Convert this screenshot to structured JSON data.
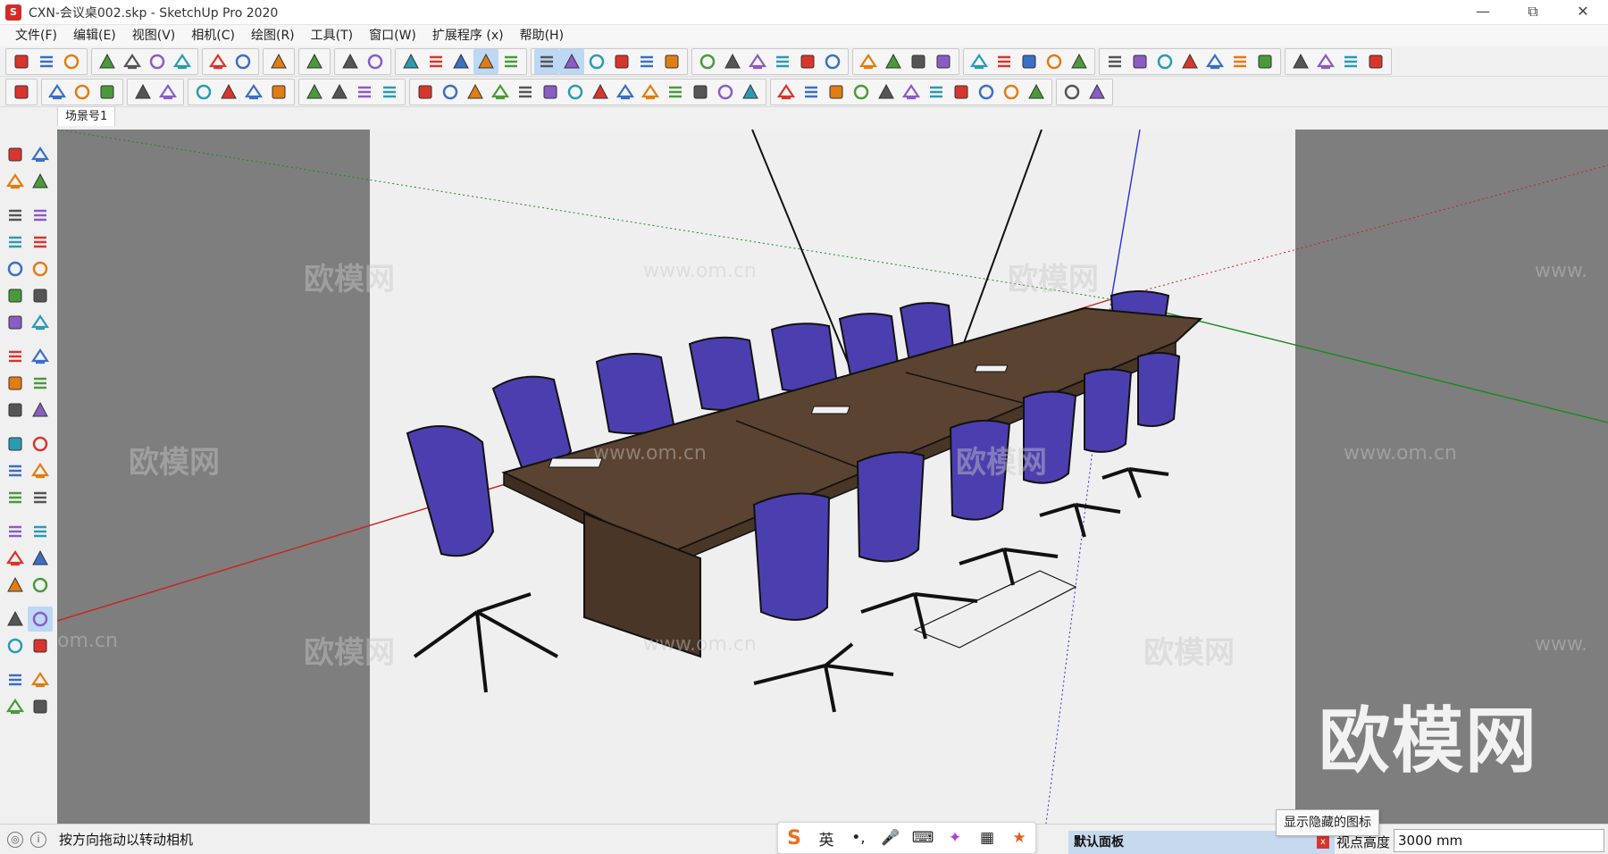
{
  "window": {
    "title": "CXN-会议桌002.skp - SketchUp Pro 2020",
    "controls": [
      "minimize",
      "restore",
      "close"
    ]
  },
  "menu": [
    "文件(F)",
    "编辑(E)",
    "视图(V)",
    "相机(C)",
    "绘图(R)",
    "工具(T)",
    "窗口(W)",
    "扩展程序 (x)",
    "帮助(H)"
  ],
  "toolbar1_groups": [
    [
      "new-icon",
      "open-icon",
      "save-icon"
    ],
    [
      "cut-icon",
      "copy-icon",
      "paste-icon",
      "erase-icon"
    ],
    [
      "undo-icon",
      "redo-icon"
    ],
    [
      "print-icon"
    ],
    [
      "model-info-icon"
    ],
    [
      "xray-icon",
      "back-edges-icon"
    ],
    [
      "wireframe-icon",
      "hidden-line-icon",
      "shaded-icon",
      "shaded-texture-icon",
      "monochrome-icon"
    ],
    [
      "iso-view-icon",
      "top-view-icon",
      "front-view-icon",
      "right-view-icon",
      "back-view-icon",
      "left-view-icon"
    ],
    [
      "component-a-icon",
      "component-b-icon",
      "component-c-icon",
      "component-d-icon",
      "component-e-icon",
      "component-f-icon"
    ],
    [
      "axes-icon",
      "section-icon",
      "display-section-icon",
      "section-fill-icon"
    ],
    [
      "sandbox-a-icon",
      "sandbox-b-icon",
      "sandbox-c-icon",
      "sandbox-d-icon",
      "sandbox-e-icon"
    ],
    [
      "ext-a-icon",
      "ext-b-icon",
      "ext-c-icon",
      "ext-d-icon",
      "ext-e-icon",
      "ext-f-icon",
      "ext-g-icon"
    ],
    [
      "plugin-a-icon",
      "plugin-b-icon",
      "plugin-c-icon",
      "plugin-d-icon"
    ]
  ],
  "toolbar2_groups": [
    [
      "check-icon"
    ],
    [
      "teapot-icon",
      "hand-icon",
      "cloud-icon"
    ],
    [
      "layout-a-icon",
      "layout-b-icon"
    ],
    [
      "window-a-icon",
      "window-b-icon",
      "window-c-icon",
      "lock-icon"
    ],
    [
      "stairs-icon",
      "grid-icon",
      "ruler-icon",
      "bars-icon"
    ],
    [
      "tool-1-icon",
      "tool-2-icon",
      "tool-3-icon",
      "tool-4-icon",
      "tool-5-icon",
      "tool-6-icon",
      "tool-7-icon",
      "tool-8-icon",
      "tool-9-icon",
      "tool-10-icon",
      "tool-11-icon",
      "tool-12-icon",
      "tool-13-icon",
      "tool-14-icon"
    ],
    [
      "curve-1-icon",
      "curve-2-icon",
      "curve-3-icon",
      "curve-4-icon",
      "curve-5-icon",
      "curve-6-icon",
      "curve-7-icon",
      "curve-8-icon",
      "curve-9-icon",
      "curve-10-icon",
      "curve-11-icon"
    ],
    [
      "round-1-icon",
      "round-2-icon"
    ]
  ],
  "scene_tab": "场景号1",
  "left_tools": [
    [
      "select-icon",
      "make-component-icon"
    ],
    [
      "paint-bucket-icon",
      "eraser-icon"
    ],
    null,
    [
      "line-icon",
      "freehand-icon"
    ],
    [
      "rectangle-icon",
      "rotated-rectangle-icon"
    ],
    [
      "circle-icon",
      "polygon-icon"
    ],
    [
      "arc-icon",
      "two-point-arc-icon"
    ],
    [
      "three-point-arc-icon",
      "pie-icon"
    ],
    null,
    [
      "move-icon",
      "push-pull-icon"
    ],
    [
      "rotate-icon",
      "follow-me-icon"
    ],
    [
      "scale-icon",
      "offset-icon"
    ],
    null,
    [
      "tape-measure-icon",
      "dimension-icon"
    ],
    [
      "protractor-icon",
      "text-icon"
    ],
    [
      "axes-tool-icon",
      "3d-text-icon"
    ],
    null,
    [
      "orbit-icon",
      "pan-icon"
    ],
    [
      "zoom-icon",
      "zoom-window-icon"
    ],
    [
      "zoom-extents-icon",
      "zoom-previous-icon"
    ],
    null,
    [
      "position-camera-icon",
      "look-around-icon"
    ],
    [
      "walk-icon",
      "section-plane-icon"
    ],
    null,
    [
      "warehouse-icon",
      "extension-warehouse-icon"
    ],
    [
      "send-to-layout-icon",
      "ruby-icon"
    ]
  ],
  "watermarks": {
    "cn": "欧模网",
    "url": "www.om.cn",
    "url_partial": "om.cn",
    "url_right": "www.",
    "logo": "欧模网"
  },
  "status": {
    "geo_icon": "geo-location-icon",
    "info_icon": "info-icon",
    "text": "按方向拖动以转动相机"
  },
  "ime": {
    "logo": "S",
    "lang": "英",
    "items": [
      "punctuation-icon",
      "microphone-icon",
      "keyboard-icon",
      "ai-icon",
      "apps-icon",
      "skin-icon"
    ]
  },
  "tooltip": "显示隐藏的图标",
  "panel": {
    "title": "默认面板",
    "close": "x"
  },
  "measurements": {
    "label": "视点高度",
    "value": "3000 mm"
  },
  "colors": {
    "viewport_bg": "#7e7e7e",
    "canvas_bg": "#efefef",
    "chair_blue": "#4b3fb0",
    "table_wood": "#5a4330",
    "axis_red": "#c8231d",
    "axis_green": "#1a8a1a",
    "axis_blue": "#2b2bd8"
  }
}
